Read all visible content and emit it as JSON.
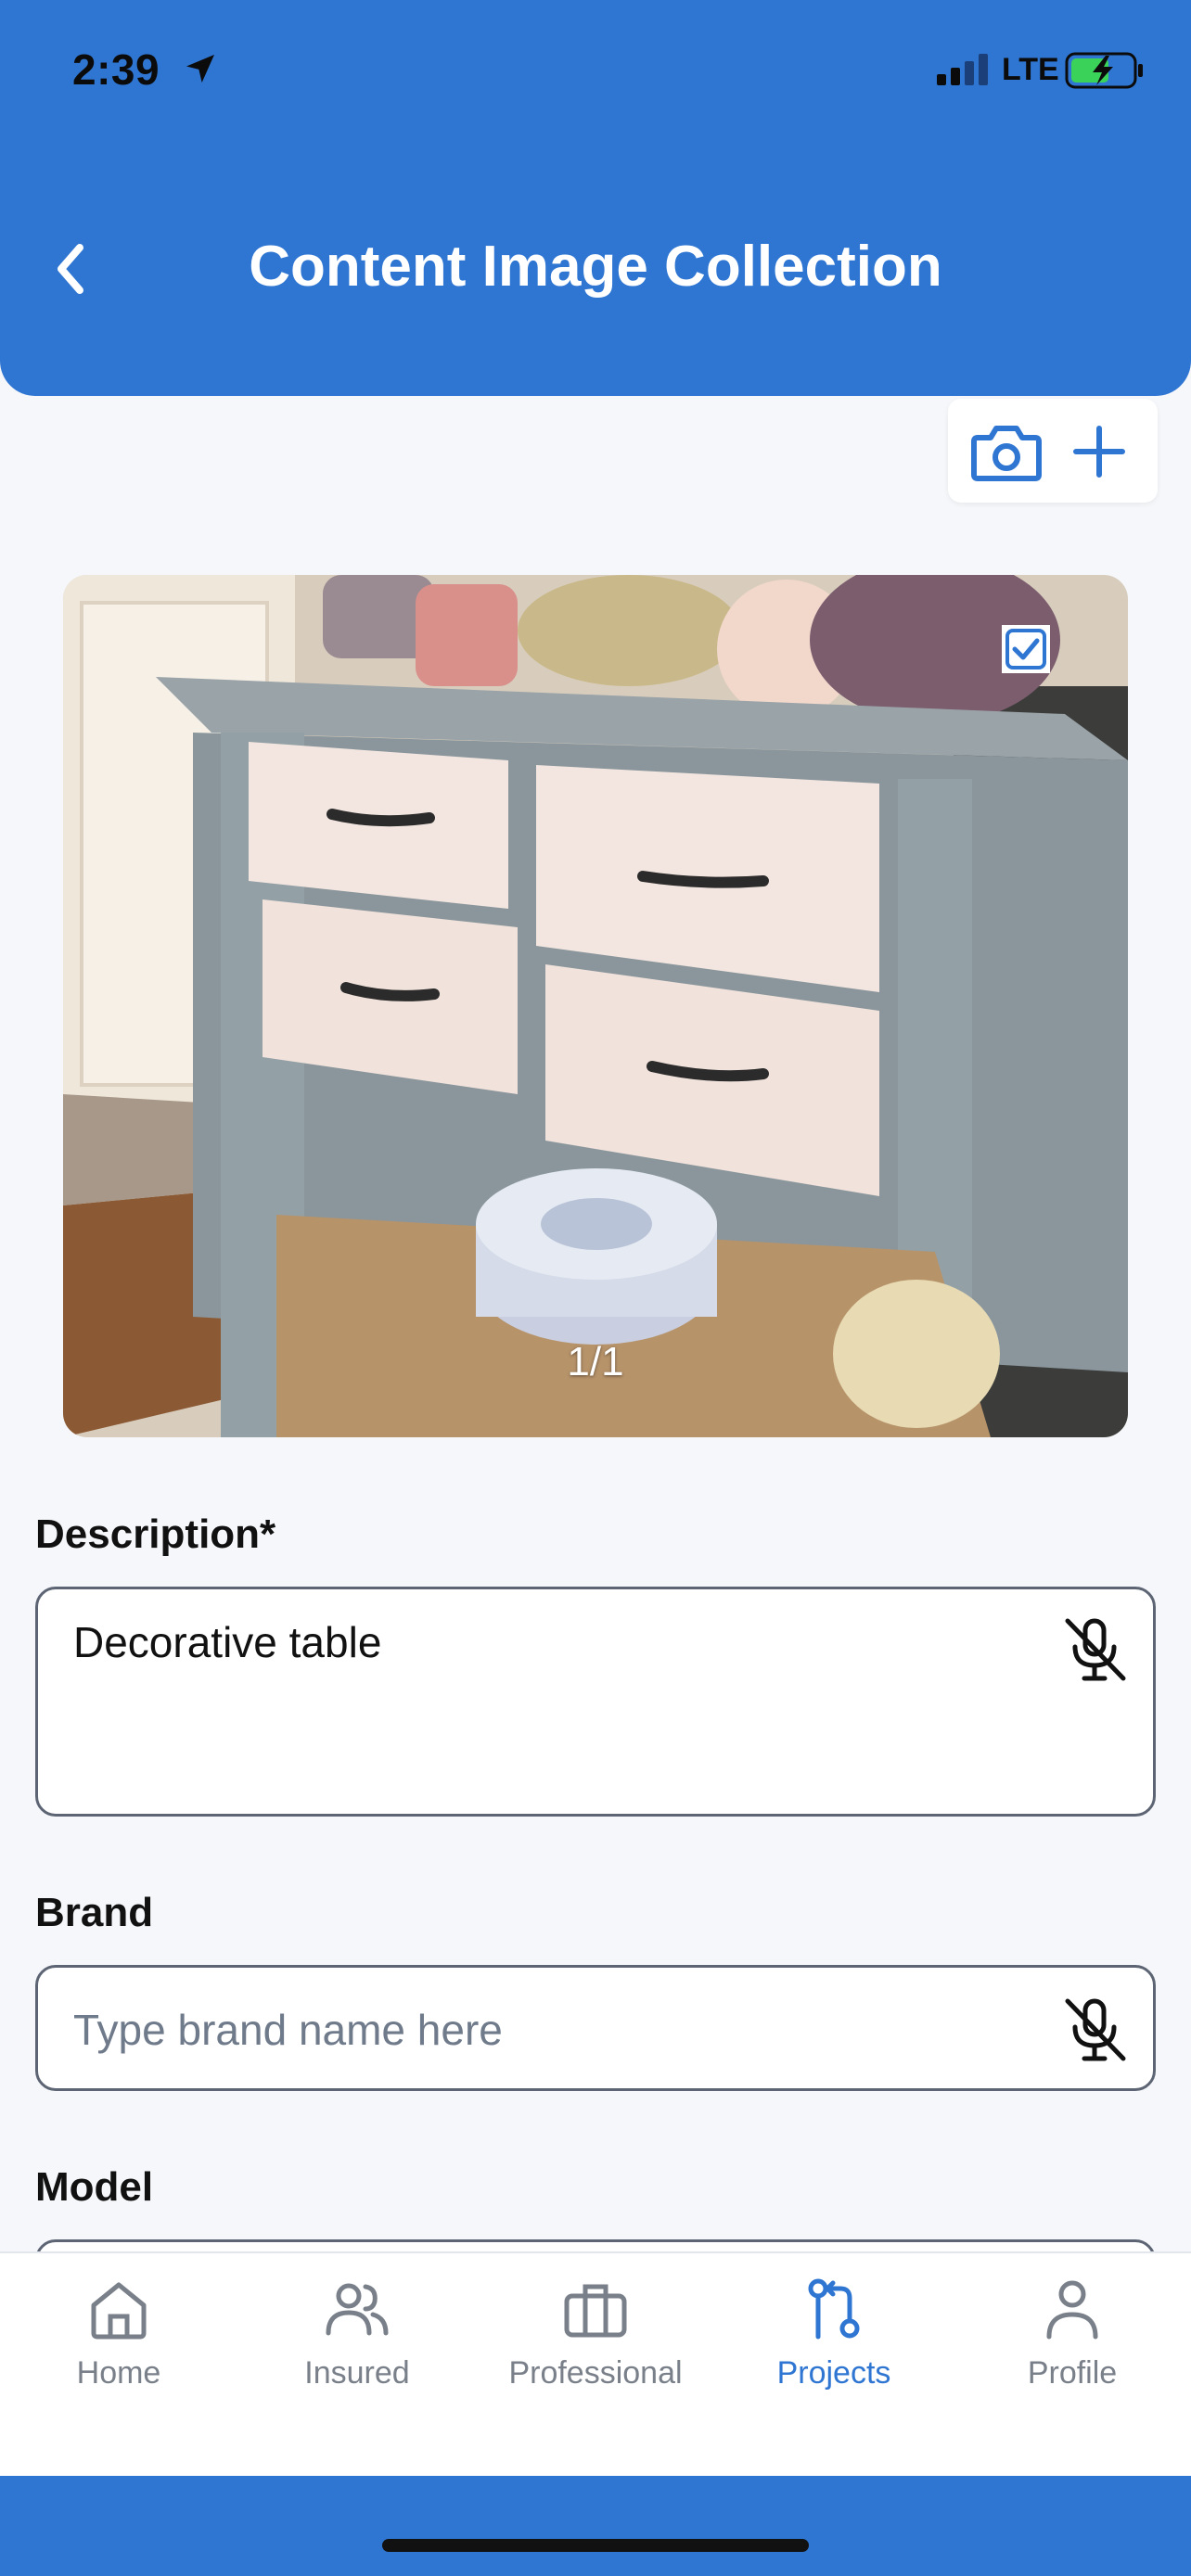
{
  "status_bar": {
    "time": "2:39",
    "network": "LTE",
    "icons": [
      "location-arrow-icon",
      "signal-icon",
      "battery-charging-icon"
    ]
  },
  "header": {
    "title": "Content Image Collection",
    "back_icon": "chevron-left-icon"
  },
  "toolbar": {
    "icons": [
      "camera-icon",
      "plus-icon"
    ]
  },
  "image": {
    "counter": "1/1",
    "selected": true
  },
  "form": {
    "description": {
      "label": "Description*",
      "value": "Decorative table"
    },
    "brand": {
      "label": "Brand",
      "placeholder": "Type brand name here"
    },
    "model": {
      "label": "Model"
    }
  },
  "nav": {
    "items": [
      {
        "label": "Home",
        "icon": "home-icon",
        "active": false
      },
      {
        "label": "Insured",
        "icon": "users-icon",
        "active": false
      },
      {
        "label": "Professional",
        "icon": "briefcase-icon",
        "active": false
      },
      {
        "label": "Projects",
        "icon": "projects-icon",
        "active": true
      },
      {
        "label": "Profile",
        "icon": "person-icon",
        "active": false
      }
    ]
  },
  "colors": {
    "primary": "#2f76d3",
    "background": "#f5f7fa",
    "inactive": "#7a808a"
  }
}
